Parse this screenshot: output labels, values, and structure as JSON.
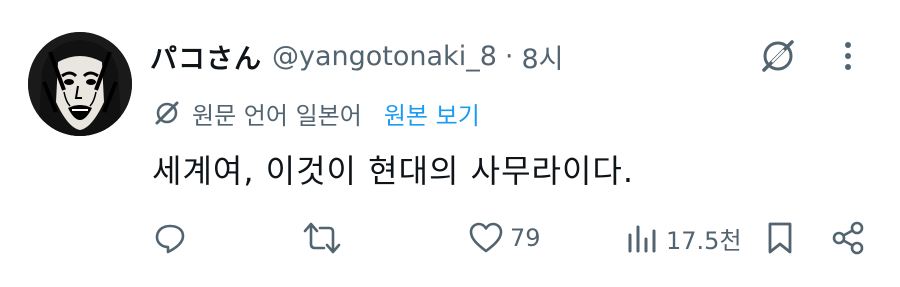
{
  "tweet": {
    "display_name": "パコさん",
    "handle": "@yangotonaki_8",
    "separator": "·",
    "time": "8시",
    "translation_note": "원문 언어 일본어",
    "show_original_label": "원본 보기",
    "text": "세계여, 이것이 현대의 사무라이다."
  },
  "actions": {
    "reply_count": "",
    "retweet_count": "",
    "like_count": "79",
    "views_count": "17.5천"
  },
  "icons": {
    "grok": "grok-icon",
    "more": "more-dots-icon",
    "translate": "translate-icon",
    "reply": "reply-icon",
    "retweet": "retweet-icon",
    "like": "heart-icon",
    "views": "views-chart-icon",
    "bookmark": "bookmark-icon",
    "share": "share-icon"
  },
  "colors": {
    "text": "#0f1419",
    "secondary": "#536471",
    "link": "#1d9bf0"
  }
}
